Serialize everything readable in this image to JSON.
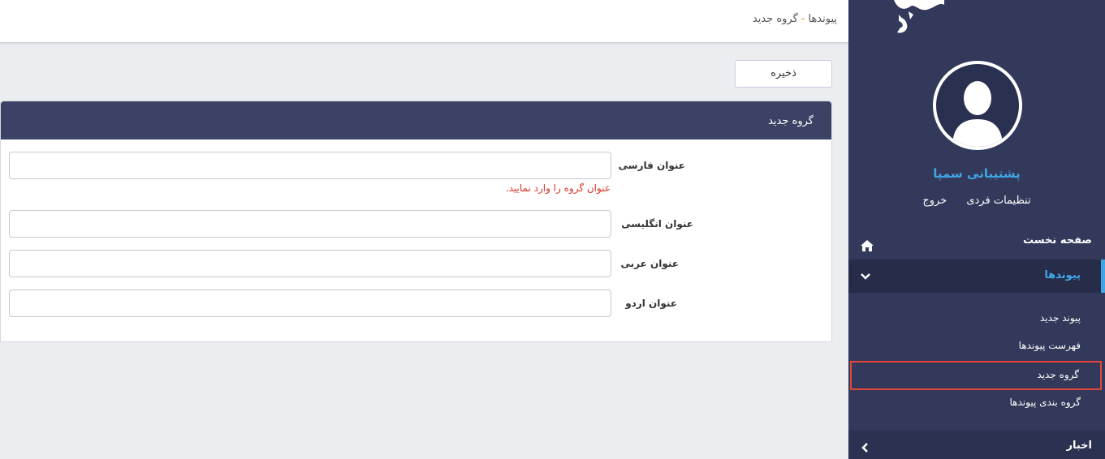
{
  "breadcrumb": {
    "parent": "پیوندها",
    "separator": "-",
    "current": "گروه جدید"
  },
  "toolbar": {
    "save_label": "ذخیره"
  },
  "panel": {
    "title": "گروه جدید",
    "fields": [
      {
        "label": "عنوان فارسی",
        "value": "",
        "error": "عنوان گروه را وارد نمایید."
      },
      {
        "label": "عنوان انگلیسی",
        "value": ""
      },
      {
        "label": "عنوان عربی",
        "value": ""
      },
      {
        "label": "عنوان اردو",
        "value": ""
      }
    ]
  },
  "sidebar": {
    "user_name": "پشتیبانی سمپا",
    "settings_label": "تنظیمات فردی",
    "logout_label": "خروج",
    "home_label": "صفحه نخست",
    "links_label": "پیوندها",
    "sub_items": [
      "پیوند جدید",
      "فهرست پیوندها",
      "گروه جدید",
      "گروه بندی پیوندها"
    ],
    "news_label": "اخبار"
  },
  "colors": {
    "sidebar_bg": "#33395a",
    "accent": "#3fa7e6",
    "error": "#d9352a",
    "highlight_border": "#e3463a"
  }
}
